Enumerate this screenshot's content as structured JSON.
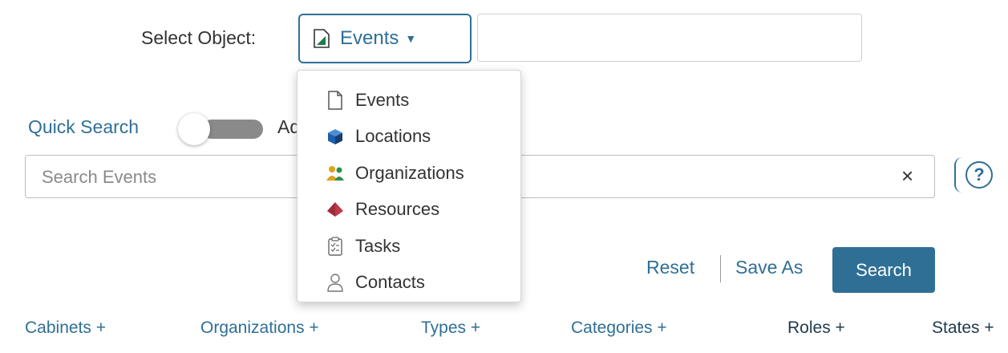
{
  "header": {
    "select_label": "Select Object:",
    "selected_object": "Events"
  },
  "quick_search": {
    "label": "Quick Search",
    "advanced_label": "Adv"
  },
  "search": {
    "placeholder": "Search Events",
    "help_label": "?"
  },
  "actions": {
    "reset_label": "Reset",
    "save_label": "Save As",
    "search_label": "Search"
  },
  "filters": {
    "cabinets": "Cabinets +",
    "organizations": "Organizations +",
    "types": "Types +",
    "categories": "Categories +",
    "roles": "Roles +",
    "states": "States +"
  },
  "menu": {
    "items": [
      {
        "label": "Events",
        "icon": "document-icon"
      },
      {
        "label": "Locations",
        "icon": "cube-icon"
      },
      {
        "label": "Organizations",
        "icon": "people-icon"
      },
      {
        "label": "Resources",
        "icon": "diamond-icon"
      },
      {
        "label": "Tasks",
        "icon": "clipboard-icon"
      },
      {
        "label": "Contacts",
        "icon": "person-icon"
      }
    ]
  },
  "colors": {
    "accent": "#2f6f96",
    "resource_red": "#c0394b",
    "location_blue": "#1f5fa8"
  }
}
